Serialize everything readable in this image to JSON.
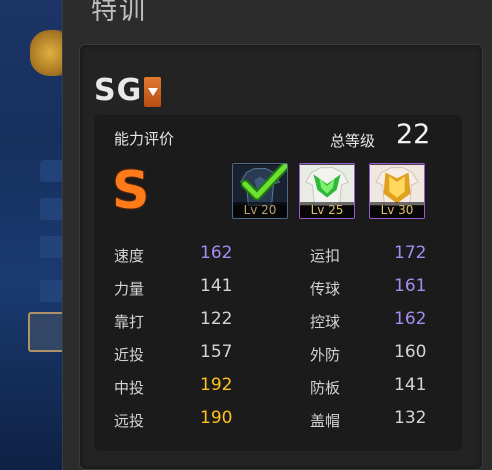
{
  "window": {
    "title": "特训"
  },
  "position": {
    "label": "SG"
  },
  "rating": {
    "label": "能力评价",
    "grade": "S",
    "total_level_label": "总等级",
    "total_level": "22"
  },
  "badges": [
    {
      "level": "Lv 20",
      "completed": true,
      "color": "#6a8a60"
    },
    {
      "level": "Lv 25",
      "completed": false,
      "color": "#38c040"
    },
    {
      "level": "Lv 30",
      "completed": false,
      "color": "#e0a020"
    }
  ],
  "stats": {
    "rows": [
      {
        "left": {
          "name": "速度",
          "value": "162",
          "tone": "purple"
        },
        "right": {
          "name": "运扣",
          "value": "172",
          "tone": "purple"
        }
      },
      {
        "left": {
          "name": "力量",
          "value": "141",
          "tone": "normal"
        },
        "right": {
          "name": "传球",
          "value": "161",
          "tone": "purple"
        }
      },
      {
        "left": {
          "name": "靠打",
          "value": "122",
          "tone": "normal"
        },
        "right": {
          "name": "控球",
          "value": "162",
          "tone": "purple"
        }
      },
      {
        "left": {
          "name": "近投",
          "value": "157",
          "tone": "normal"
        },
        "right": {
          "name": "外防",
          "value": "160",
          "tone": "normal"
        }
      },
      {
        "left": {
          "name": "中投",
          "value": "192",
          "tone": "gold"
        },
        "right": {
          "name": "防板",
          "value": "141",
          "tone": "normal"
        }
      },
      {
        "left": {
          "name": "远投",
          "value": "190",
          "tone": "gold"
        },
        "right": {
          "name": "盖帽",
          "value": "132",
          "tone": "normal"
        }
      }
    ]
  },
  "colors": {
    "purple": "#a58cf2",
    "gold": "#ffc21a",
    "grade": "#ff7a18",
    "dropdown": "#d0601e"
  }
}
